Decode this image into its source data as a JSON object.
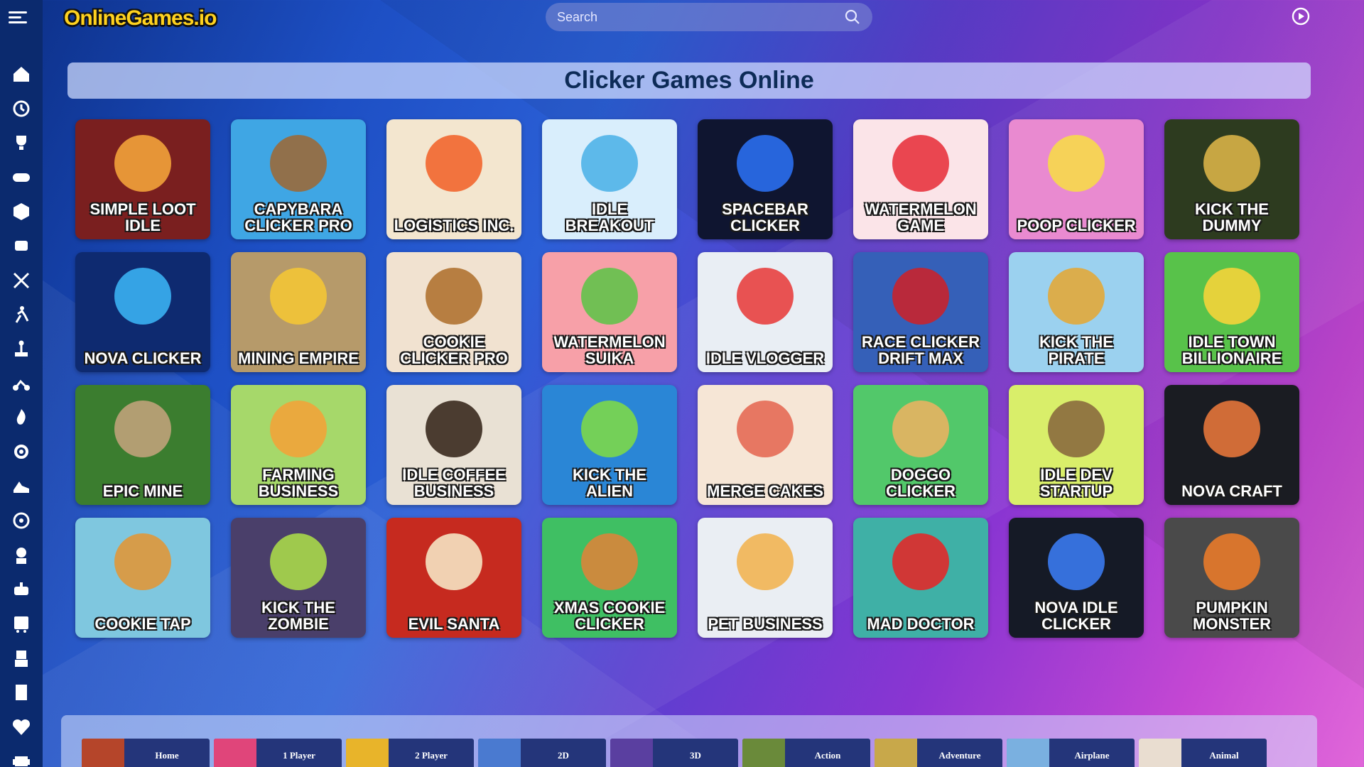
{
  "header": {
    "logo": "OnlineGames.io",
    "search_placeholder": "Search"
  },
  "sidebar": {
    "icons": [
      "home-icon",
      "history-icon",
      "trophy-icon",
      "gamepad-icon",
      "dice-icon",
      "joystick-icon",
      "swords-icon",
      "runner-icon",
      "arcade-stick-icon",
      "motorbike-icon",
      "fire-icon",
      "gear-icon",
      "sneaker-icon",
      "steering-wheel-icon",
      "astronaut-icon",
      "controller-icon",
      "bus-icon",
      "robot-icon",
      "building-icon",
      "heart-icon",
      "space-invader-icon"
    ]
  },
  "page_title": "Clicker Games Online",
  "games": [
    {
      "title": "Simple Loot Idle",
      "bg": "#7a1f1f",
      "accent": "#f2a23a"
    },
    {
      "title": "Capybara Clicker Pro",
      "bg": "#3fa6e4",
      "accent": "#9a6a3a"
    },
    {
      "title": "Logistics Inc.",
      "bg": "#f3e6cf",
      "accent": "#f2662e"
    },
    {
      "title": "Idle Breakout",
      "bg": "#d9eefc",
      "accent": "#4fb3e8"
    },
    {
      "title": "Spacebar Clicker",
      "bg": "#0f1530",
      "accent": "#2a6ef0"
    },
    {
      "title": "Watermelon Game",
      "bg": "#fbe4e8",
      "accent": "#e8343f"
    },
    {
      "title": "Poop Clicker",
      "bg": "#e98ad0",
      "accent": "#f7d94a"
    },
    {
      "title": "Kick The Dummy",
      "bg": "#2d3b1f",
      "accent": "#d8b247"
    },
    {
      "title": "Nova Clicker",
      "bg": "#0e2a70",
      "accent": "#3ab0f2"
    },
    {
      "title": "Mining Empire",
      "bg": "#b69a6a",
      "accent": "#f3c536"
    },
    {
      "title": "Cookie Clicker Pro",
      "bg": "#f1e2d0",
      "accent": "#b07331"
    },
    {
      "title": "Watermelon Suika",
      "bg": "#f7a0a8",
      "accent": "#62c24a"
    },
    {
      "title": "Idle Vlogger",
      "bg": "#e9eef4",
      "accent": "#e84040"
    },
    {
      "title": "Race Clicker Drift Max",
      "bg": "#3560b8",
      "accent": "#c8232e"
    },
    {
      "title": "Kick The Pirate",
      "bg": "#9bd1ef",
      "accent": "#e2a83a"
    },
    {
      "title": "Idle Town Billionaire",
      "bg": "#58c24a",
      "accent": "#f5d43a"
    },
    {
      "title": "Epic Mine",
      "bg": "#3b7d2f",
      "accent": "#c0a27a"
    },
    {
      "title": "Farming Business",
      "bg": "#a6d86a",
      "accent": "#f2a43a"
    },
    {
      "title": "Idle Coffee Business",
      "bg": "#e9e1d4",
      "accent": "#3a2a1e"
    },
    {
      "title": "Kick The Alien",
      "bg": "#2a86d6",
      "accent": "#7cd84a"
    },
    {
      "title": "Merge Cakes",
      "bg": "#f6e6d6",
      "accent": "#e66a55"
    },
    {
      "title": "Doggo Clicker",
      "bg": "#52c86a",
      "accent": "#e8b262"
    },
    {
      "title": "Idle Dev Startup",
      "bg": "#d9ee6a",
      "accent": "#8a6a3e"
    },
    {
      "title": "Nova Craft",
      "bg": "#1a1c22",
      "accent": "#e4763a"
    },
    {
      "title": "Cookie Tap",
      "bg": "#7fc7df",
      "accent": "#e0973a"
    },
    {
      "title": "Kick The Zombie",
      "bg": "#4a3f6a",
      "accent": "#a8d84a"
    },
    {
      "title": "Evil Santa",
      "bg": "#c62a1f",
      "accent": "#f5e3c2"
    },
    {
      "title": "Xmas Cookie Clicker",
      "bg": "#3fbf63",
      "accent": "#d9853a"
    },
    {
      "title": "Pet Business",
      "bg": "#eaeef3",
      "accent": "#f2b453"
    },
    {
      "title": "Mad Doctor",
      "bg": "#3fb0a6",
      "accent": "#e02a2a"
    },
    {
      "title": "Nova Idle Clicker",
      "bg": "#151a26",
      "accent": "#3a7af0"
    },
    {
      "title": "Pumpkin Monster",
      "bg": "#4a4a4a",
      "accent": "#e87a2a"
    }
  ],
  "categories": [
    {
      "label": "Home",
      "thumb": "#b5452a"
    },
    {
      "label": "1 Player",
      "thumb": "#e0457a"
    },
    {
      "label": "2 Player",
      "thumb": "#e8b42a"
    },
    {
      "label": "2D",
      "thumb": "#4a7ad0"
    },
    {
      "label": "3D",
      "thumb": "#5a3fa0"
    },
    {
      "label": "Action",
      "thumb": "#6a8a3a"
    },
    {
      "label": "Adventure",
      "thumb": "#c8a84a"
    },
    {
      "label": "Airplane",
      "thumb": "#7ab0e0"
    },
    {
      "label": "Animal",
      "thumb": "#e9ddd0"
    }
  ]
}
